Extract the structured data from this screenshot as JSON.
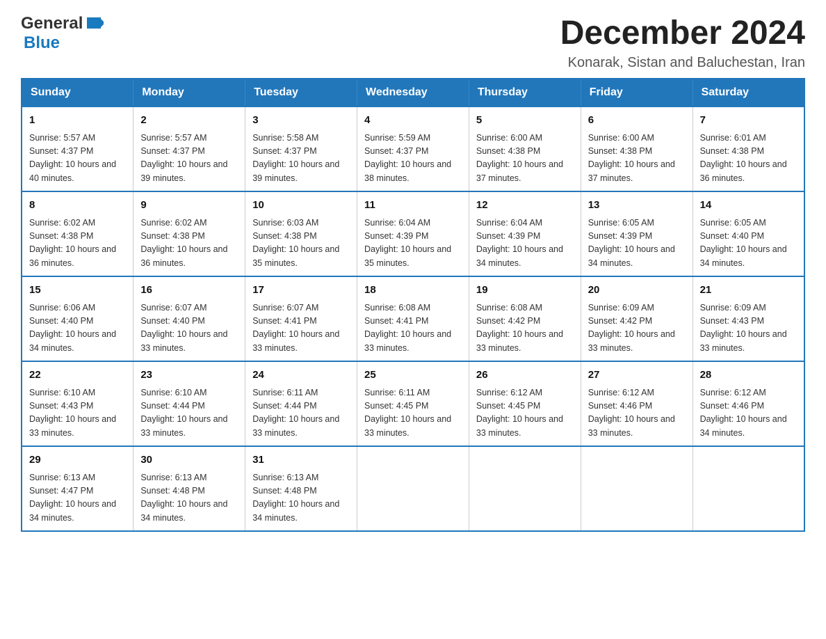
{
  "header": {
    "logo_general": "General",
    "logo_blue": "Blue",
    "main_title": "December 2024",
    "subtitle": "Konarak, Sistan and Baluchestan, Iran"
  },
  "calendar": {
    "days_of_week": [
      "Sunday",
      "Monday",
      "Tuesday",
      "Wednesday",
      "Thursday",
      "Friday",
      "Saturday"
    ],
    "weeks": [
      [
        {
          "day": "1",
          "sunrise": "Sunrise: 5:57 AM",
          "sunset": "Sunset: 4:37 PM",
          "daylight": "Daylight: 10 hours and 40 minutes."
        },
        {
          "day": "2",
          "sunrise": "Sunrise: 5:57 AM",
          "sunset": "Sunset: 4:37 PM",
          "daylight": "Daylight: 10 hours and 39 minutes."
        },
        {
          "day": "3",
          "sunrise": "Sunrise: 5:58 AM",
          "sunset": "Sunset: 4:37 PM",
          "daylight": "Daylight: 10 hours and 39 minutes."
        },
        {
          "day": "4",
          "sunrise": "Sunrise: 5:59 AM",
          "sunset": "Sunset: 4:37 PM",
          "daylight": "Daylight: 10 hours and 38 minutes."
        },
        {
          "day": "5",
          "sunrise": "Sunrise: 6:00 AM",
          "sunset": "Sunset: 4:38 PM",
          "daylight": "Daylight: 10 hours and 37 minutes."
        },
        {
          "day": "6",
          "sunrise": "Sunrise: 6:00 AM",
          "sunset": "Sunset: 4:38 PM",
          "daylight": "Daylight: 10 hours and 37 minutes."
        },
        {
          "day": "7",
          "sunrise": "Sunrise: 6:01 AM",
          "sunset": "Sunset: 4:38 PM",
          "daylight": "Daylight: 10 hours and 36 minutes."
        }
      ],
      [
        {
          "day": "8",
          "sunrise": "Sunrise: 6:02 AM",
          "sunset": "Sunset: 4:38 PM",
          "daylight": "Daylight: 10 hours and 36 minutes."
        },
        {
          "day": "9",
          "sunrise": "Sunrise: 6:02 AM",
          "sunset": "Sunset: 4:38 PM",
          "daylight": "Daylight: 10 hours and 36 minutes."
        },
        {
          "day": "10",
          "sunrise": "Sunrise: 6:03 AM",
          "sunset": "Sunset: 4:38 PM",
          "daylight": "Daylight: 10 hours and 35 minutes."
        },
        {
          "day": "11",
          "sunrise": "Sunrise: 6:04 AM",
          "sunset": "Sunset: 4:39 PM",
          "daylight": "Daylight: 10 hours and 35 minutes."
        },
        {
          "day": "12",
          "sunrise": "Sunrise: 6:04 AM",
          "sunset": "Sunset: 4:39 PM",
          "daylight": "Daylight: 10 hours and 34 minutes."
        },
        {
          "day": "13",
          "sunrise": "Sunrise: 6:05 AM",
          "sunset": "Sunset: 4:39 PM",
          "daylight": "Daylight: 10 hours and 34 minutes."
        },
        {
          "day": "14",
          "sunrise": "Sunrise: 6:05 AM",
          "sunset": "Sunset: 4:40 PM",
          "daylight": "Daylight: 10 hours and 34 minutes."
        }
      ],
      [
        {
          "day": "15",
          "sunrise": "Sunrise: 6:06 AM",
          "sunset": "Sunset: 4:40 PM",
          "daylight": "Daylight: 10 hours and 34 minutes."
        },
        {
          "day": "16",
          "sunrise": "Sunrise: 6:07 AM",
          "sunset": "Sunset: 4:40 PM",
          "daylight": "Daylight: 10 hours and 33 minutes."
        },
        {
          "day": "17",
          "sunrise": "Sunrise: 6:07 AM",
          "sunset": "Sunset: 4:41 PM",
          "daylight": "Daylight: 10 hours and 33 minutes."
        },
        {
          "day": "18",
          "sunrise": "Sunrise: 6:08 AM",
          "sunset": "Sunset: 4:41 PM",
          "daylight": "Daylight: 10 hours and 33 minutes."
        },
        {
          "day": "19",
          "sunrise": "Sunrise: 6:08 AM",
          "sunset": "Sunset: 4:42 PM",
          "daylight": "Daylight: 10 hours and 33 minutes."
        },
        {
          "day": "20",
          "sunrise": "Sunrise: 6:09 AM",
          "sunset": "Sunset: 4:42 PM",
          "daylight": "Daylight: 10 hours and 33 minutes."
        },
        {
          "day": "21",
          "sunrise": "Sunrise: 6:09 AM",
          "sunset": "Sunset: 4:43 PM",
          "daylight": "Daylight: 10 hours and 33 minutes."
        }
      ],
      [
        {
          "day": "22",
          "sunrise": "Sunrise: 6:10 AM",
          "sunset": "Sunset: 4:43 PM",
          "daylight": "Daylight: 10 hours and 33 minutes."
        },
        {
          "day": "23",
          "sunrise": "Sunrise: 6:10 AM",
          "sunset": "Sunset: 4:44 PM",
          "daylight": "Daylight: 10 hours and 33 minutes."
        },
        {
          "day": "24",
          "sunrise": "Sunrise: 6:11 AM",
          "sunset": "Sunset: 4:44 PM",
          "daylight": "Daylight: 10 hours and 33 minutes."
        },
        {
          "day": "25",
          "sunrise": "Sunrise: 6:11 AM",
          "sunset": "Sunset: 4:45 PM",
          "daylight": "Daylight: 10 hours and 33 minutes."
        },
        {
          "day": "26",
          "sunrise": "Sunrise: 6:12 AM",
          "sunset": "Sunset: 4:45 PM",
          "daylight": "Daylight: 10 hours and 33 minutes."
        },
        {
          "day": "27",
          "sunrise": "Sunrise: 6:12 AM",
          "sunset": "Sunset: 4:46 PM",
          "daylight": "Daylight: 10 hours and 33 minutes."
        },
        {
          "day": "28",
          "sunrise": "Sunrise: 6:12 AM",
          "sunset": "Sunset: 4:46 PM",
          "daylight": "Daylight: 10 hours and 34 minutes."
        }
      ],
      [
        {
          "day": "29",
          "sunrise": "Sunrise: 6:13 AM",
          "sunset": "Sunset: 4:47 PM",
          "daylight": "Daylight: 10 hours and 34 minutes."
        },
        {
          "day": "30",
          "sunrise": "Sunrise: 6:13 AM",
          "sunset": "Sunset: 4:48 PM",
          "daylight": "Daylight: 10 hours and 34 minutes."
        },
        {
          "day": "31",
          "sunrise": "Sunrise: 6:13 AM",
          "sunset": "Sunset: 4:48 PM",
          "daylight": "Daylight: 10 hours and 34 minutes."
        },
        null,
        null,
        null,
        null
      ]
    ]
  }
}
